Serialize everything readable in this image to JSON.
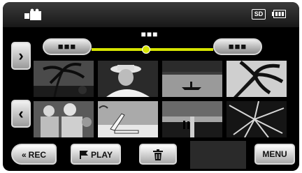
{
  "status": {
    "mode_icon": "video-camera-icon",
    "storage_label": "SD",
    "battery_icon": "battery-icon"
  },
  "navigation": {
    "page_marker": "■■■",
    "prev_group_label": "■■■",
    "next_group_label": "■■■",
    "scroll_up_glyph": "›",
    "scroll_down_glyph": "‹",
    "slider_position": 0.45
  },
  "thumbnails": [
    {
      "scene": "palm-tree-beach"
    },
    {
      "scene": "man-with-hat"
    },
    {
      "scene": "canoe-on-lake"
    },
    {
      "scene": "palm-leaves-sky"
    },
    {
      "scene": "people-group"
    },
    {
      "scene": "beach-chair"
    },
    {
      "scene": "sunset-couple"
    },
    {
      "scene": "starburst-leaves"
    }
  ],
  "toolbar": {
    "rec_label": "REC",
    "play_label": "PLAY",
    "delete_icon": "trash-icon",
    "menu_label": "MENU"
  },
  "colors": {
    "accent": "#d6e400",
    "background": "#000000"
  }
}
